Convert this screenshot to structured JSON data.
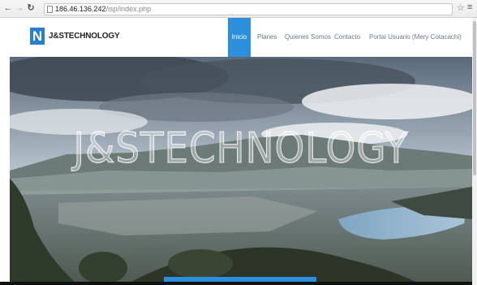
{
  "browser": {
    "back_icon": "arrow-left-icon",
    "forward_icon": "arrow-right-icon",
    "reload_icon": "reload-icon",
    "url_host": "186.46.136.242",
    "url_path": "/isp/index.php",
    "star_icon": "star-icon",
    "menu_icon": "hamburger-menu-icon"
  },
  "header": {
    "logo_letter": "N",
    "brand": "J&STECHNOLOGY",
    "nav": [
      {
        "label": "Inicio",
        "active": true
      },
      {
        "label": "Planes",
        "active": false
      },
      {
        "label": "Quienes Somos",
        "active": false
      },
      {
        "label": "Contacto",
        "active": false
      },
      {
        "label": "Portal Usuario (Mery Cotacachi)",
        "active": false
      }
    ]
  },
  "hero": {
    "title": "J&STECHNOLOGY"
  },
  "colors": {
    "accent": "#2d8fdc",
    "logo": "#2a7fc8"
  }
}
